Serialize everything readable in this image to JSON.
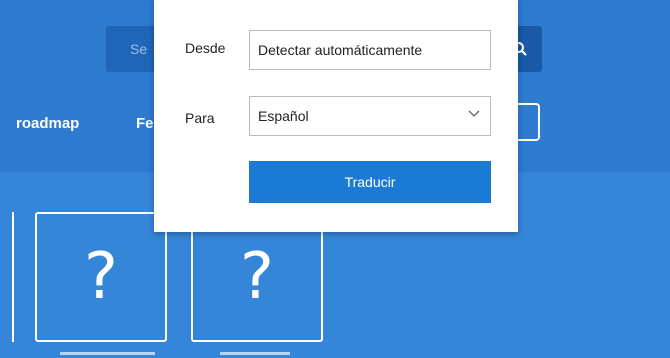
{
  "header": {
    "search_placeholder": "Se",
    "search_icon": "search-icon"
  },
  "nav": {
    "item_roadmap": "roadmap",
    "item_partial": "Fe"
  },
  "tiles": [
    {
      "symbol": "?"
    },
    {
      "symbol": "?"
    }
  ],
  "translate_popup": {
    "from_label": "Desde",
    "from_value": "Detectar automáticamente",
    "to_label": "Para",
    "to_value": "Español",
    "to_icon": "chevron-down-icon",
    "translate_button": "Traducir"
  },
  "colors": {
    "page_bg": "#2e7bcf",
    "accent_button": "#1a7ad4"
  }
}
